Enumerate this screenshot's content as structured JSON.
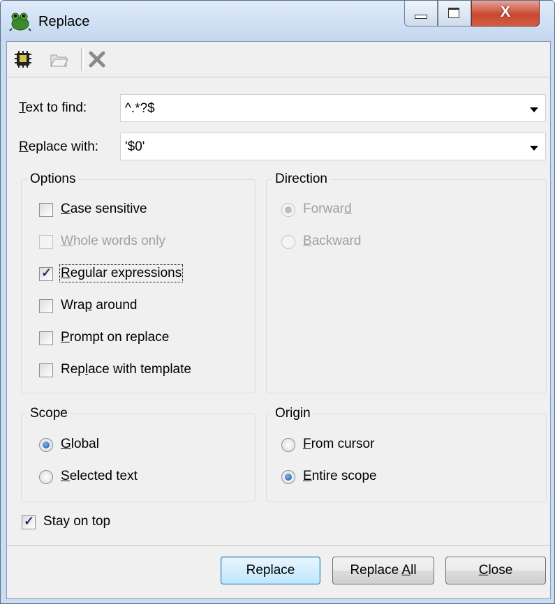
{
  "window": {
    "title": "Replace",
    "caption": {
      "min": "minimize",
      "max": "maximize",
      "close": "X"
    }
  },
  "toolbar": {
    "icons": [
      "save-template-icon",
      "open-folder-icon",
      "delete-icon"
    ]
  },
  "find": {
    "label_u": "T",
    "label_rest": "ext to find:",
    "value": "^.*?$"
  },
  "replace": {
    "label_u": "R",
    "label_rest": "eplace with:",
    "value": "'$0'"
  },
  "options": {
    "title": "Options",
    "case_u": "C",
    "case_rest": "ase sensitive",
    "whole_u": "W",
    "whole_rest": "hole words only",
    "regex_u": "R",
    "regex_rest": "egular expressions",
    "wrap_pre": "Wra",
    "wrap_u": "p",
    "wrap_post": " around",
    "prompt_u": "P",
    "prompt_rest": "rompt on replace",
    "template_pre": "Rep",
    "template_u": "l",
    "template_post": "ace with template"
  },
  "direction": {
    "title": "Direction",
    "forward_pre": "Forwar",
    "forward_u": "d",
    "backward_u": "B",
    "backward_rest": "ackward"
  },
  "scope": {
    "title": "Scope",
    "global_u": "G",
    "global_rest": "lobal",
    "selected_u": "S",
    "selected_rest": "elected text"
  },
  "origin": {
    "title": "Origin",
    "cursor_u": "F",
    "cursor_rest": "rom cursor",
    "entire_u": "E",
    "entire_rest": "ntire scope"
  },
  "stay_on_top": "Stay on top",
  "buttons": {
    "replace": "Replace",
    "replace_all_pre": "Replace ",
    "replace_all_u": "A",
    "replace_all_post": "ll",
    "close_u": "C",
    "close_rest": "lose"
  }
}
